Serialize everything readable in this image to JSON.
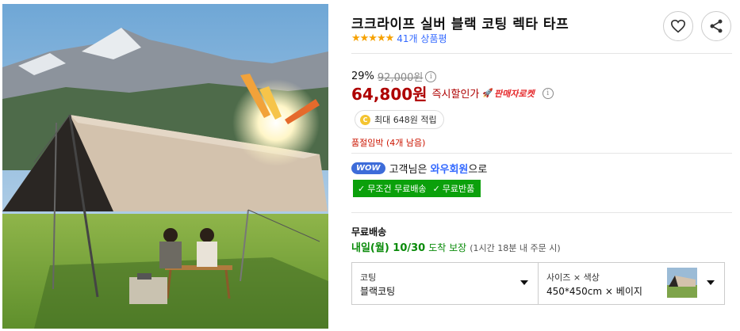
{
  "product": {
    "title": "크크라이프 실버 블랙 코팅 렉타 타프",
    "rating_stars": "★★★★★",
    "review_count": "41개 상품평"
  },
  "actions": {
    "wishlist_icon": "heart-icon",
    "share_icon": "share-icon"
  },
  "price": {
    "discount_rate": "29%",
    "original_price": "92,000원",
    "sale_price": "64,800원",
    "sale_label": "즉시할인가",
    "seller_rocket": "판매자로켓",
    "info_glyph": "i"
  },
  "points": {
    "coin_label": "C",
    "text": "최대 648원 적립"
  },
  "stock_notice": "품절임박 (4개 남음)",
  "membership": {
    "badge": "WOW",
    "text_prefix": "고객님은 ",
    "highlight": "와우회원",
    "text_suffix": "으로",
    "free_shipping": "무조건 무료배송",
    "free_return": "무료반품",
    "check_glyph": "✓"
  },
  "shipping": {
    "title": "무료배송",
    "date": "내일(월) 10/30",
    "guarantee": "도착 보장",
    "note": "(1시간 18분 내 주문 시)"
  },
  "options": [
    {
      "label": "코팅",
      "value": "블랙코팅"
    },
    {
      "label": "사이즈 × 색상",
      "value": "450*450cm × 베이지"
    }
  ],
  "colors": {
    "price_red": "#ae0000",
    "green": "#0ba00b",
    "link_blue": "#346aff",
    "star": "#f6a100"
  }
}
